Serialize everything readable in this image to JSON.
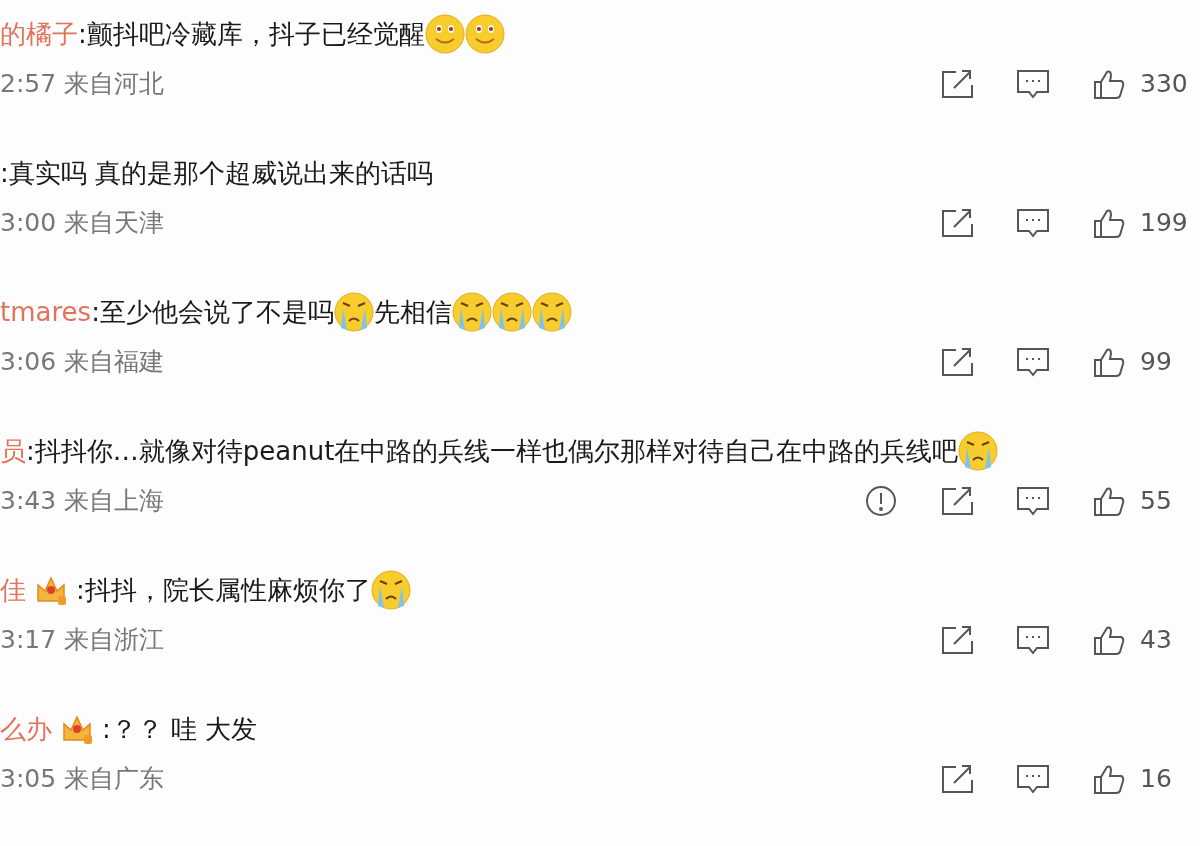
{
  "comments": [
    {
      "username": "的橘子",
      "badge": false,
      "content": [
        {
          "kind": "text",
          "text": ":颤抖吧冷藏库，抖子已经觉醒"
        },
        {
          "kind": "smile"
        },
        {
          "kind": "smile"
        }
      ],
      "time": "2:57 来自河北",
      "report": false,
      "likes": "330"
    },
    {
      "badge": false,
      "content": [
        {
          "kind": "text",
          "text": ":真实吗 真的是那个超威说出来的话吗"
        }
      ],
      "time": "3:00 来自天津",
      "report": false,
      "likes": "199"
    },
    {
      "username": "tmares",
      "badge": false,
      "content": [
        {
          "kind": "text",
          "text": ":至少他会说了不是吗"
        },
        {
          "kind": "cry"
        },
        {
          "kind": "text",
          "text": "先相信 "
        },
        {
          "kind": "cry"
        },
        {
          "kind": "cry"
        },
        {
          "kind": "cry"
        }
      ],
      "time": "3:06 来自福建",
      "report": false,
      "likes": "99"
    },
    {
      "username": "员",
      "badge": false,
      "content": [
        {
          "kind": "text",
          "text": ":抖抖你…就像对待peanut在中路的兵线一样也偶尔那样对待自己在中路的兵线吧"
        },
        {
          "kind": "cry"
        }
      ],
      "time": "3:43 来自上海",
      "report": true,
      "likes": "55"
    },
    {
      "username": "佳",
      "badge": true,
      "content": [
        {
          "kind": "text",
          "text": ":抖抖，院长属性麻烦你了"
        },
        {
          "kind": "cry"
        }
      ],
      "time": "3:17 来自浙江",
      "report": false,
      "likes": "43"
    },
    {
      "username": "么办",
      "badge": true,
      "content": [
        {
          "kind": "text",
          "text": ":？？ 哇 大发"
        }
      ],
      "time": "3:05 来自广东",
      "report": false,
      "likes": "16"
    }
  ]
}
